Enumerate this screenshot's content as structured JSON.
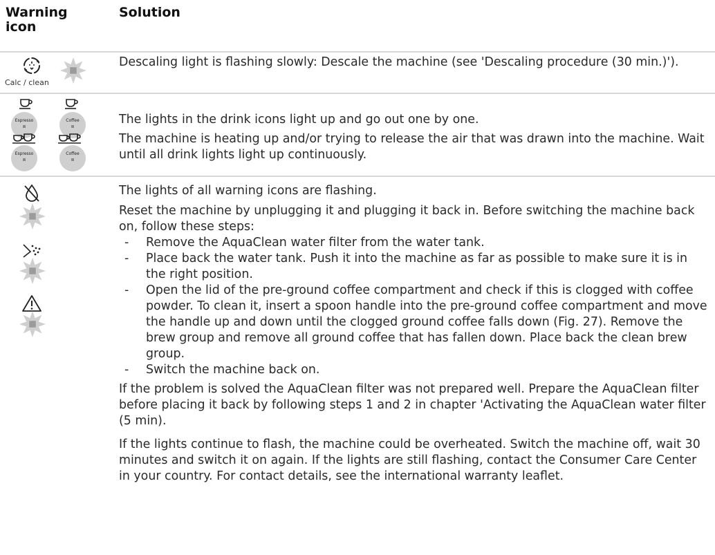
{
  "headers": {
    "icon": "Warning\nicon",
    "solution": "Solution"
  },
  "row1": {
    "icon_label": "Calc / clean",
    "text": "Descaling light is flashing slowly: Descale the machine (see 'Descaling procedure (30 min.)')."
  },
  "row2": {
    "buttons": [
      "Espresso",
      "Coffee",
      "Espresso",
      "Coffee"
    ],
    "p1": "The lights in the drink icons light up and go out one by one.",
    "p2": "The machine is heating up and/or trying to release the air that was drawn into the machine. Wait until all drink lights light up continuously."
  },
  "row3": {
    "p1": "The lights of all warning icons are flashing.",
    "p2": "Reset the machine by unplugging it and plugging it back in. Before switching the machine back on, follow these steps:",
    "dash": "-",
    "steps": [
      "Remove the AquaClean water filter from the water tank.",
      "Place back the water tank. Push it into the machine as far as possible to make sure it is in the right position.",
      "Open the lid of the pre-ground coffee compartment and check if this is clogged with coffee powder. To clean it, insert a spoon handle into the pre-ground coffee compartment and move the handle up and down until the clogged ground coffee falls down (Fig. 27). Remove the brew group and remove all ground coffee that has fallen down. Place back the clean brew group.",
      "Switch the machine back on."
    ],
    "p3": "If the problem is solved the AquaClean filter was not prepared well. Prepare the AquaClean filter before placing it back by following steps 1 and 2 in chapter 'Activating the AquaClean water filter (5 min).",
    "p4": "If the lights continue to flash, the machine could be overheated. Switch the machine off, wait 30 minutes and switch it on again. If the lights are still flashing, contact the Consumer Care Center in your country. For contact details, see the international warranty leaflet."
  },
  "icons": {
    "calc_clean": "calc-clean-icon",
    "espresso": "espresso-cup-icon",
    "coffee": "coffee-cup-icon",
    "no_water": "no-water-icon",
    "grounds": "coffee-grounds-icon",
    "warning": "warning-triangle-icon",
    "flash": "flashing-light-icon"
  },
  "colors": {
    "rule": "#d7d7d7",
    "button": "#cfcfcf",
    "flash": "#cfcfcf"
  }
}
